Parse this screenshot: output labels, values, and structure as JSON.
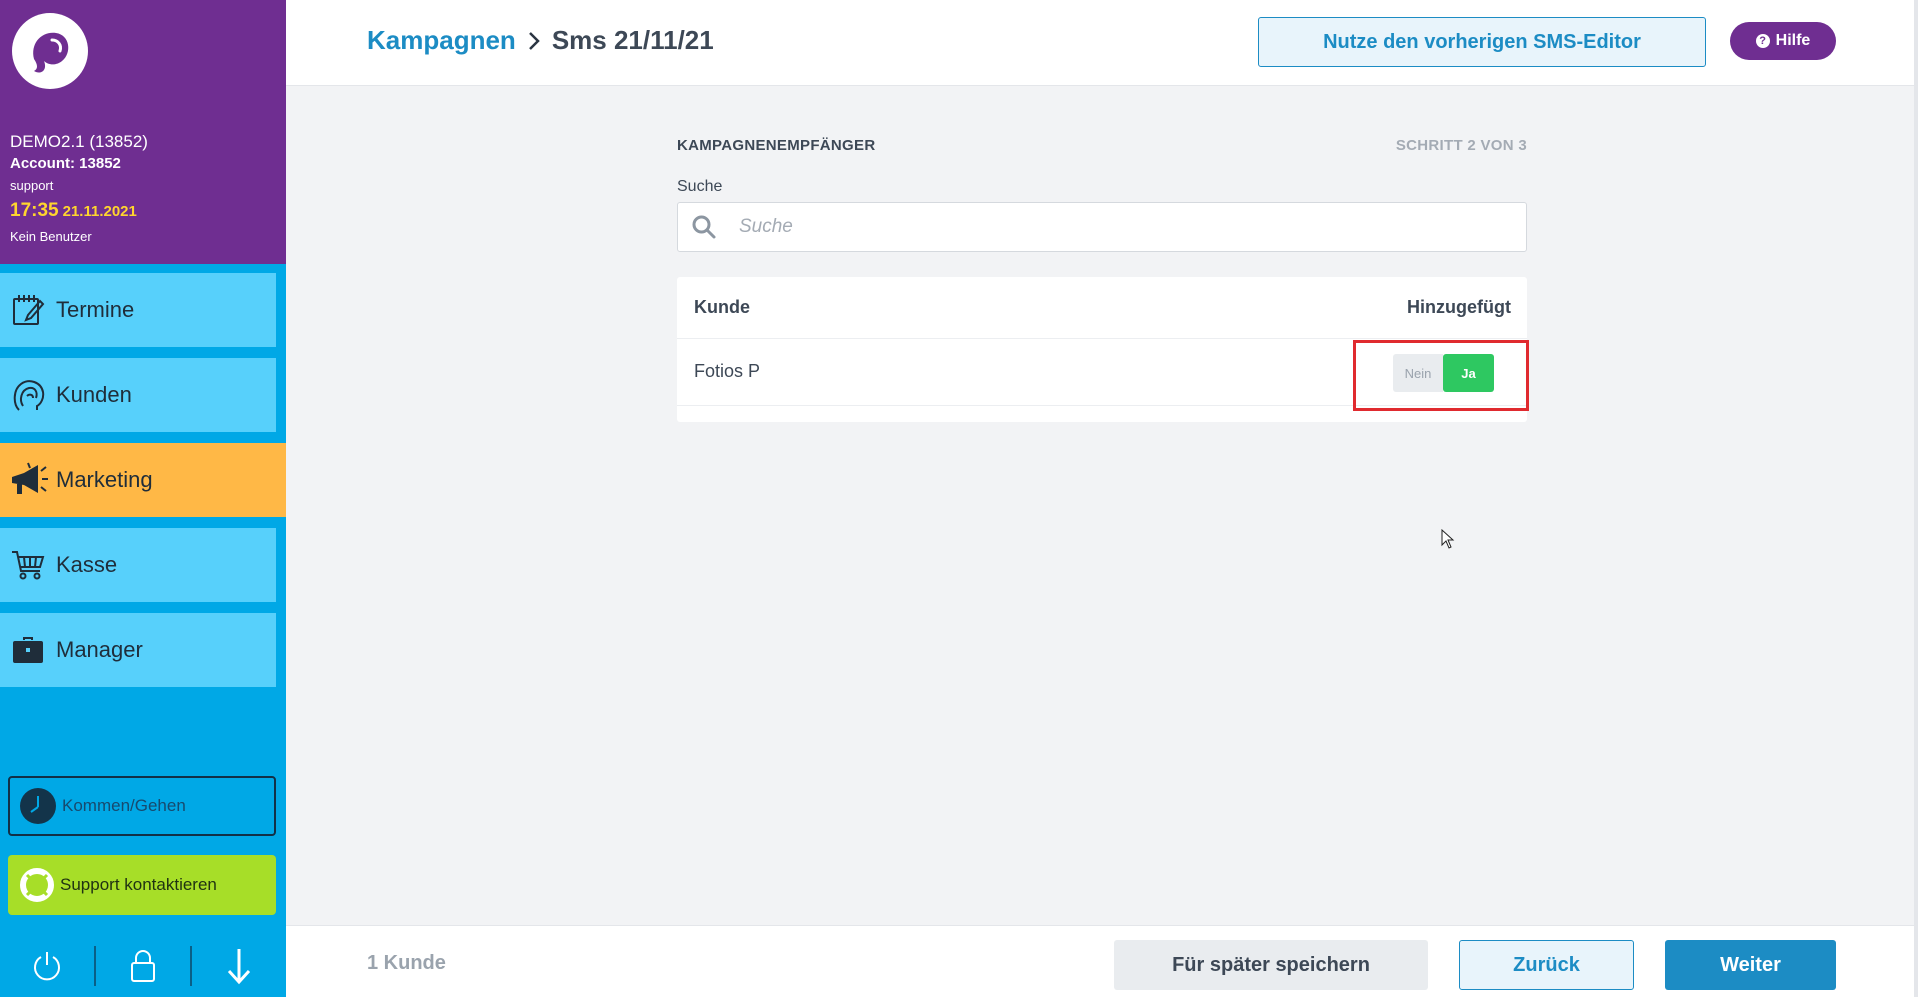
{
  "sidebar": {
    "logo_icon": "salon-logo-icon",
    "info": {
      "company": "DEMO2.1 (13852)",
      "account": "Account: 13852",
      "user": "support",
      "time": "17:35",
      "date": "21.11.2021",
      "employee": "Kein Benutzer"
    },
    "items": [
      {
        "label": "Termine",
        "icon": "calendar-edit-icon"
      },
      {
        "label": "Kunden",
        "icon": "customer-head-icon"
      },
      {
        "label": "Marketing",
        "icon": "megaphone-icon",
        "active": true
      },
      {
        "label": "Kasse",
        "icon": "shopping-cart-icon"
      },
      {
        "label": "Manager",
        "icon": "briefcase-icon"
      }
    ],
    "clock_button": "Kommen/Gehen",
    "support_button": "Support kontaktieren",
    "bottom_icons": [
      "power-icon",
      "lock-icon",
      "arrow-down-icon"
    ]
  },
  "header": {
    "breadcrumb_parent": "Kampagnen",
    "breadcrumb_current": "Sms 21/11/21",
    "prev_editor_button": "Nutze den vorherigen SMS-Editor",
    "help_button": "Hilfe"
  },
  "main": {
    "section_title": "KAMPAGNENEMPFÄNGER",
    "step": "SCHRITT 2 VON 3",
    "search_label": "Suche",
    "search_placeholder": "Suche",
    "table": {
      "columns": [
        "Kunde",
        "Hinzugefügt"
      ],
      "rows": [
        {
          "name": "Fotios P",
          "no_label": "Nein",
          "yes_label": "Ja",
          "selected": "Ja"
        }
      ]
    }
  },
  "footer": {
    "count": "1 Kunde",
    "save_later": "Für später speichern",
    "back": "Zurück",
    "next": "Weiter"
  },
  "colors": {
    "sidebar_header": "#6f2e91",
    "sidebar_bg": "#00a8e6",
    "nav_item": "#57d0fb",
    "nav_active": "#ffb846",
    "accent": "#1c8cc4",
    "toggle_yes": "#2ec861",
    "support": "#a7de28",
    "highlight": "#e02a2f"
  }
}
